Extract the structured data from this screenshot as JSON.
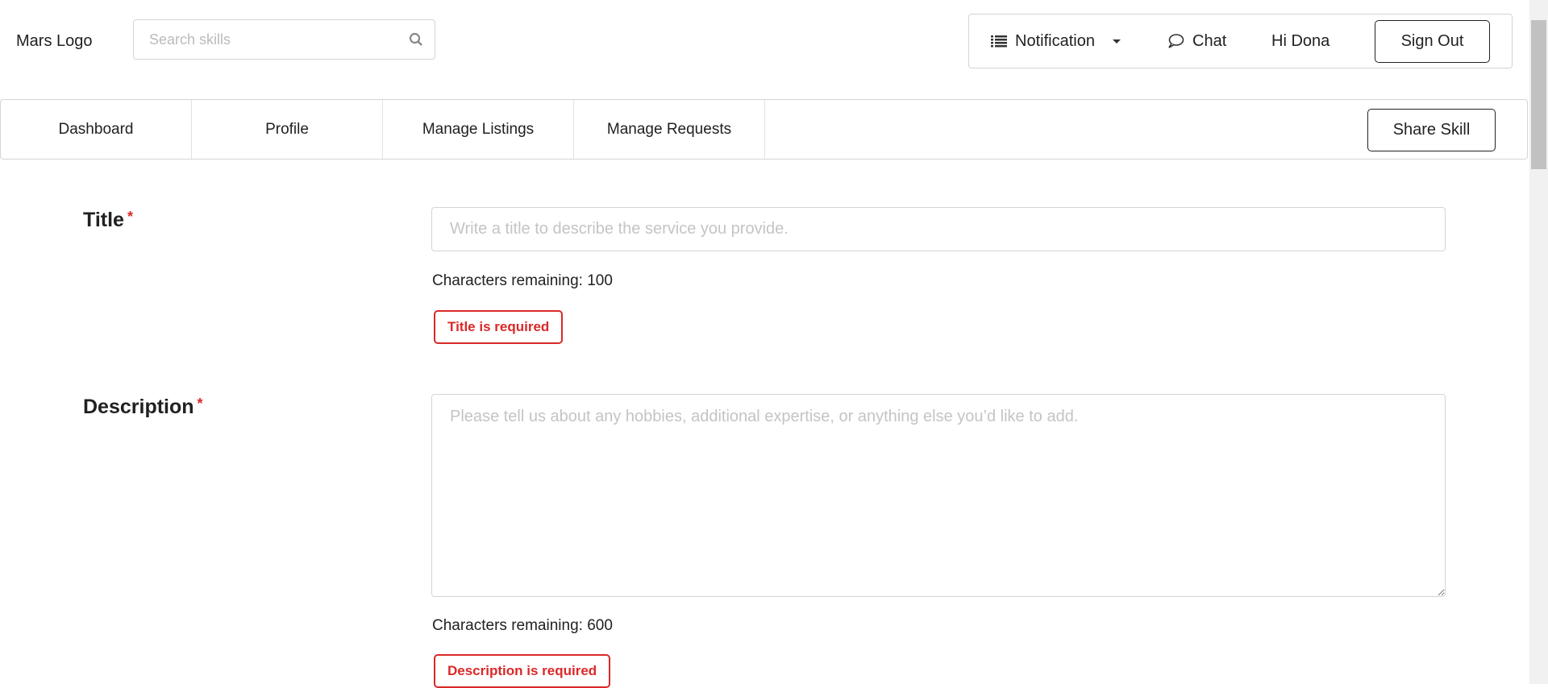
{
  "header": {
    "logo": "Mars Logo",
    "search_placeholder": "Search skills",
    "notification": "Notification",
    "chat": "Chat",
    "greeting": "Hi Dona",
    "sign_out": "Sign Out"
  },
  "nav": {
    "items": [
      "Dashboard",
      "Profile",
      "Manage Listings",
      "Manage Requests"
    ],
    "share_skill": "Share Skill"
  },
  "form": {
    "title": {
      "label": "Title",
      "required": "*",
      "placeholder": "Write a title to describe the service you provide.",
      "remaining": "Characters remaining: 100",
      "error": "Title is required"
    },
    "description": {
      "label": "Description",
      "required": "*",
      "placeholder": "Please tell us about any hobbies, additional expertise, or anything else you’d like to add.",
      "remaining": "Characters remaining: 600",
      "error": "Description is required"
    }
  },
  "colors": {
    "error": "#db2828"
  }
}
